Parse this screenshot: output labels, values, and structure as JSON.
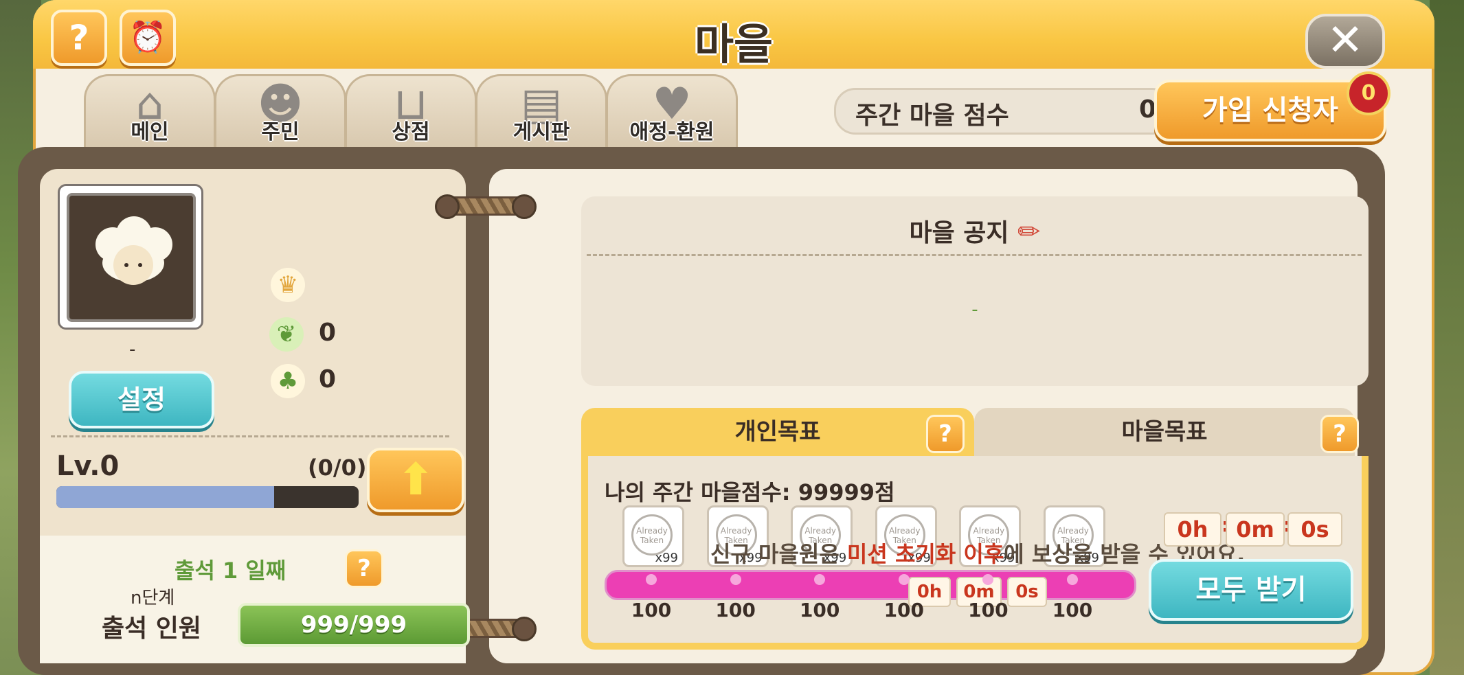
{
  "window": {
    "title": "마을",
    "help_label": "?",
    "close_label": "✕"
  },
  "tabs": [
    {
      "label": "메인",
      "icon": "house-icon"
    },
    {
      "label": "주민",
      "icon": "resident-icon"
    },
    {
      "label": "상점",
      "icon": "basket-icon"
    },
    {
      "label": "게시판",
      "icon": "board-icon"
    },
    {
      "label": "애정-환원",
      "icon": "heart-icon"
    }
  ],
  "weekly_score": {
    "label": "주간 마을 점수",
    "value": "0"
  },
  "join_requests": {
    "label": "가입 신청자",
    "count": "0"
  },
  "profile": {
    "name": "-",
    "settings_label": "설정",
    "stats": [
      {
        "icon": "crown-chick-icon",
        "value": ""
      },
      {
        "icon": "leaf-icon",
        "value": "0"
      },
      {
        "icon": "sprout-chick-icon",
        "value": "0"
      }
    ],
    "level": "Lv.0",
    "level_count": "(0/0)",
    "level_progress": 0.72,
    "upgrade_icon": "⬆"
  },
  "attendance": {
    "day_text": "출석 1 일째",
    "help_label": "?",
    "stage": "n단계",
    "label": "출석 인원",
    "value": "999/999"
  },
  "notice": {
    "title": "마을 공지",
    "edit_icon": "✏",
    "body": "-"
  },
  "goals": {
    "tabs": [
      {
        "label": "개인목표",
        "help": "?"
      },
      {
        "label": "마을목표",
        "help": "?"
      }
    ],
    "my_score": "나의 주간 마을점수: 99999점",
    "stamp_text": "Already Taken",
    "rewards": [
      {
        "card_amount": "x99",
        "threshold": "100"
      },
      {
        "card_amount": "x99",
        "threshold": "100"
      },
      {
        "card_amount": "x99",
        "threshold": "100"
      },
      {
        "card_amount": "x99",
        "threshold": "100"
      },
      {
        "card_amount": "x99",
        "threshold": "100"
      },
      {
        "card_amount": "x99",
        "threshold": "100"
      }
    ],
    "overlay_message": {
      "part1": "신규 마을원은 ",
      "emphasis": "미션 초기화 이후",
      "part2": "에 보상을 받을 수 있어요."
    },
    "timer_main": {
      "h": "0h",
      "m": "0m",
      "s": "0s"
    },
    "timer_small": {
      "h": "0h",
      "m": "0m",
      "s": "0s"
    },
    "receive_all_label": "모두 받기"
  },
  "colors": {
    "title_bar": "#f9c643",
    "accent_orange": "#ef9a2b",
    "accent_teal": "#3eb6c1",
    "track_pink": "#ec3fb4",
    "badge_red": "#c7242a"
  }
}
